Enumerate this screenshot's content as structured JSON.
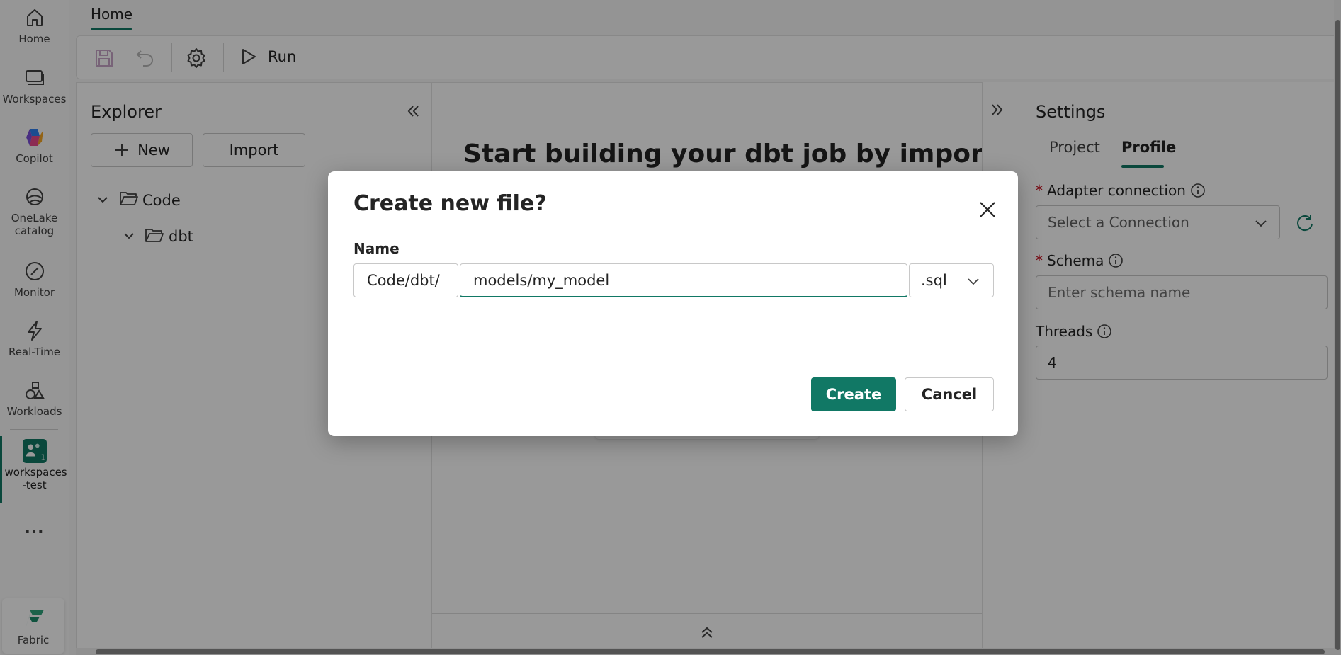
{
  "rail": {
    "items": [
      {
        "label": "Home",
        "icon": "home-icon"
      },
      {
        "label": "Workspaces",
        "icon": "workspaces-icon"
      },
      {
        "label": "Copilot",
        "icon": "copilot-icon"
      },
      {
        "label": "OneLake catalog",
        "icon": "onelake-icon"
      },
      {
        "label": "Monitor",
        "icon": "monitor-icon"
      },
      {
        "label": "Real-Time",
        "icon": "lightning-icon"
      },
      {
        "label": "Workloads",
        "icon": "workloads-icon"
      },
      {
        "label": "workspaces -test",
        "icon": "workspace-test-icon"
      }
    ],
    "more": "...",
    "fabric_label": "Fabric"
  },
  "top": {
    "tab": "Home"
  },
  "toolbar": {
    "run_label": "Run"
  },
  "explorer": {
    "title": "Explorer",
    "new_label": "New",
    "import_label": "Import",
    "tree": [
      {
        "label": "Code"
      },
      {
        "label": "dbt"
      }
    ]
  },
  "center": {
    "heading": "Start building your dbt job by importing a"
  },
  "settings": {
    "title": "Settings",
    "tabs": [
      {
        "label": "Project"
      },
      {
        "label": "Profile"
      }
    ],
    "adapter_label": "Adapter connection",
    "adapter_placeholder": "Select a Connection",
    "schema_label": "Schema",
    "schema_placeholder": "Enter schema name",
    "threads_label": "Threads",
    "threads_value": "4"
  },
  "dialog": {
    "title": "Create new file?",
    "name_label": "Name",
    "prefix": "Code/dbt/",
    "name_value": "models/my_model",
    "extension": ".sql",
    "create_label": "Create",
    "cancel_label": "Cancel"
  },
  "colors": {
    "accent": "#117865",
    "required": "#c50f1f"
  }
}
